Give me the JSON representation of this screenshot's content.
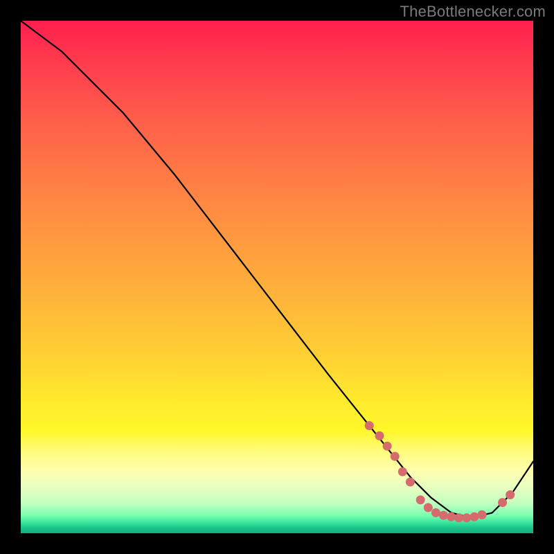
{
  "attribution": "TheBottlenecker.com",
  "chart_data": {
    "type": "line",
    "title": "",
    "xlabel": "",
    "ylabel": "",
    "xlim": [
      0,
      100
    ],
    "ylim": [
      0,
      100
    ],
    "grid": false,
    "legend": false,
    "series": [
      {
        "name": "bottleneck-curve",
        "x": [
          0,
          4,
          8,
          12,
          20,
          30,
          40,
          50,
          60,
          68,
          72,
          76,
          80,
          84,
          88,
          92,
          96,
          100
        ],
        "y": [
          100,
          97,
          94,
          90,
          82,
          70,
          57,
          44,
          31,
          21,
          16,
          11,
          7,
          4,
          3,
          4,
          8,
          14
        ]
      }
    ],
    "markers": {
      "name": "sampled-points",
      "points": [
        {
          "x": 68,
          "y": 21
        },
        {
          "x": 70,
          "y": 19
        },
        {
          "x": 71.5,
          "y": 17
        },
        {
          "x": 73,
          "y": 15
        },
        {
          "x": 74.5,
          "y": 12
        },
        {
          "x": 76,
          "y": 10
        },
        {
          "x": 78,
          "y": 6.5
        },
        {
          "x": 79.5,
          "y": 5
        },
        {
          "x": 81,
          "y": 4
        },
        {
          "x": 82.5,
          "y": 3.5
        },
        {
          "x": 84,
          "y": 3.2
        },
        {
          "x": 85.5,
          "y": 3
        },
        {
          "x": 87,
          "y": 3
        },
        {
          "x": 88.5,
          "y": 3.2
        },
        {
          "x": 90,
          "y": 3.6
        },
        {
          "x": 94,
          "y": 6
        },
        {
          "x": 95.5,
          "y": 7.5
        }
      ]
    },
    "background": {
      "type": "vertical-gradient",
      "stops": [
        {
          "pos": 0.0,
          "color": "#ff1f4e"
        },
        {
          "pos": 0.35,
          "color": "#ff8a42"
        },
        {
          "pos": 0.7,
          "color": "#ffe330"
        },
        {
          "pos": 0.88,
          "color": "#fcffa8"
        },
        {
          "pos": 0.97,
          "color": "#5dffa9"
        },
        {
          "pos": 1.0,
          "color": "#15b07f"
        }
      ]
    }
  }
}
